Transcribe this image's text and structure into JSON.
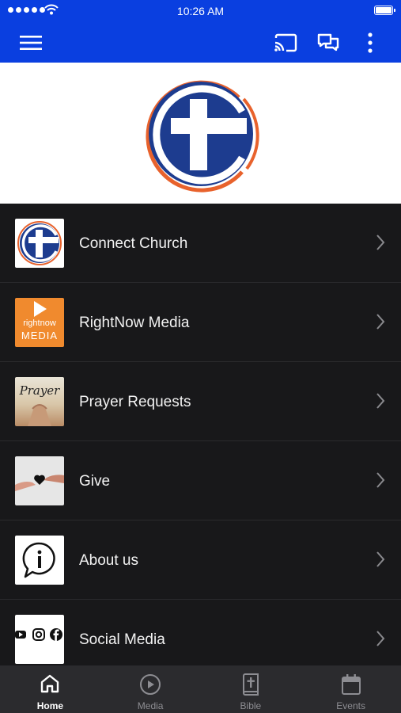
{
  "status_bar": {
    "time": "10:26 AM",
    "battery_level": 1.0
  },
  "app_bar": {
    "icons": [
      "menu-icon",
      "cast-icon",
      "chat-icon",
      "more-vert-icon"
    ]
  },
  "colors": {
    "brand_blue": "#0a3fe0",
    "logo_navy": "#1d3c8f",
    "logo_orange": "#e8622c",
    "list_bg": "#18181a"
  },
  "menu": {
    "items": [
      {
        "label": "Connect Church",
        "icon": "church-logo"
      },
      {
        "label": "RightNow Media",
        "icon": "rightnow-media-logo",
        "thumb_line1": "rightnow",
        "thumb_line2": "MEDIA"
      },
      {
        "label": "Prayer Requests",
        "icon": "prayer-image",
        "thumb_text": "Prayer"
      },
      {
        "label": "Give",
        "icon": "give-hands-heart-image"
      },
      {
        "label": "About us",
        "icon": "info-bubble-icon"
      },
      {
        "label": "Social Media",
        "icon": "social-media-icons"
      }
    ]
  },
  "tabs": [
    {
      "label": "Home",
      "icon": "home-icon",
      "active": true
    },
    {
      "label": "Media",
      "icon": "play-circle-icon",
      "active": false
    },
    {
      "label": "Bible",
      "icon": "bible-icon",
      "active": false
    },
    {
      "label": "Events",
      "icon": "calendar-icon",
      "active": false
    }
  ]
}
